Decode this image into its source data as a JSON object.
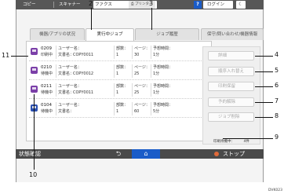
{
  "topbar": {
    "copy": "コピー",
    "scanner": "スキャナー",
    "fax": "ファクス",
    "printer": "プリンター",
    "help": "?",
    "login": "ログイン",
    "moon": "☾"
  },
  "tabs": [
    {
      "label": "機器/アプリの状況"
    },
    {
      "label": "実行中ジョブ"
    },
    {
      "label": "ジョブ履歴"
    },
    {
      "label": "保守/問い合わせ/機器情報"
    }
  ],
  "jobs": [
    {
      "number": "0209",
      "state": "印刷中",
      "user_label": "ユーザー名：",
      "doc_label": "文書名：",
      "doc": "COPY0011",
      "copies_label": "部数：",
      "copies": "1",
      "pages_label": "ページ：",
      "pages": "30",
      "time_label": "予想時間：",
      "time": "1分",
      "icon": "print-job-icon"
    },
    {
      "number": "0210",
      "state": "待機中",
      "user_label": "ユーザー名：",
      "doc_label": "文書名：",
      "doc": "COPY0012",
      "copies_label": "部数：",
      "copies": "1",
      "pages_label": "ページ：",
      "pages": "25",
      "time_label": "予想時間：",
      "time": "1分",
      "icon": "print-job-icon"
    },
    {
      "number": "0211",
      "state": "待機中",
      "user_label": "ユーザー名：",
      "doc_label": "文書名：",
      "doc": "COPY0011",
      "copies_label": "部数：",
      "copies": "1",
      "pages_label": "ページ：",
      "pages": "25",
      "time_label": "予想時間：",
      "time": "1分",
      "icon": "print-job-icon"
    },
    {
      "number": "0104",
      "state": "待機中",
      "user_label": "ユーザー名：",
      "doc_label": "文書名：",
      "doc": "",
      "copies_label": "部数：",
      "copies": "1",
      "pages_label": "ページ：",
      "pages": "60",
      "time_label": "予想時間：",
      "time": "5分",
      "icon": "scan-job-icon"
    }
  ],
  "buttons": {
    "details": "詳細",
    "reorder": "順序入れ替え",
    "stop_print": "印刷保留",
    "resume": "予約解除",
    "delete": "ジョブ削除"
  },
  "job_count": {
    "label": "印刷待機中：",
    "value": "4件"
  },
  "bottombar": {
    "status": "状態確認",
    "back": "⮌",
    "home": "⌂",
    "stop": "ストップ"
  },
  "callouts": [
    "2",
    "3",
    "4",
    "5",
    "6",
    "7",
    "8",
    "9",
    "10",
    "11"
  ],
  "figure_code": "DVK023"
}
